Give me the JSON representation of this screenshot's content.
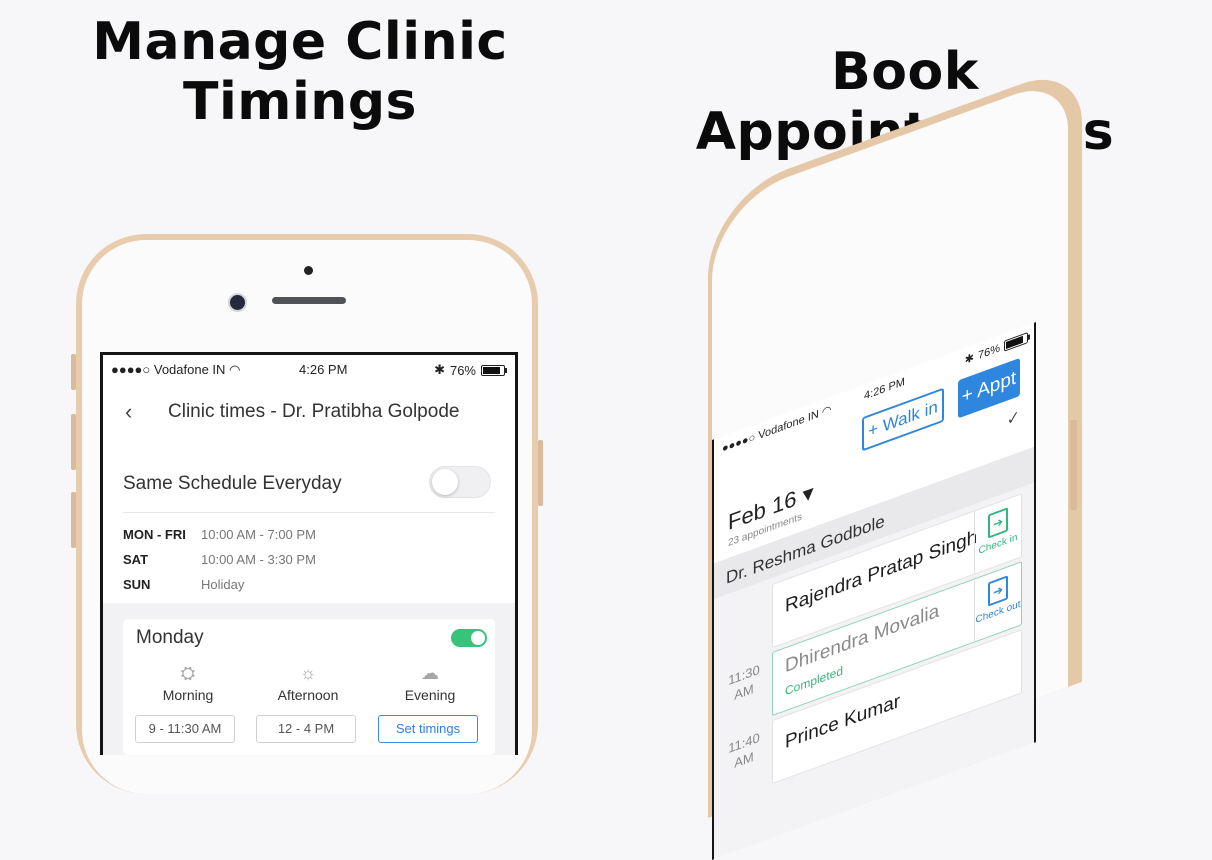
{
  "headlines": {
    "left": "Manage Clinic Timings",
    "right": "Book Appointments"
  },
  "left_phone": {
    "status": {
      "carrier": "●●●●○ Vodafone IN",
      "time": "4:26 PM",
      "battery": "76%",
      "battery_level": 0.76
    },
    "nav": {
      "back_icon": "chevron-left-icon",
      "title": "Clinic times - Dr. Pratibha Golpode"
    },
    "same_schedule": {
      "label": "Same Schedule Everyday",
      "enabled": false
    },
    "schedule": [
      {
        "days": "MON - FRI",
        "hours": "10:00 AM - 7:00 PM"
      },
      {
        "days": "SAT",
        "hours": "10:00 AM - 3:30 PM"
      },
      {
        "days": "SUN",
        "hours": "Holiday"
      }
    ],
    "day_card": {
      "day": "Monday",
      "enabled": true,
      "slots": [
        {
          "label": "Morning",
          "icon": "sunrise-icon",
          "value": "9 - 11:30 AM"
        },
        {
          "label": "Afternoon",
          "icon": "sun-icon",
          "value": "12 - 4 PM"
        },
        {
          "label": "Evening",
          "icon": "sunset-icon",
          "value": "Set timings"
        }
      ]
    },
    "accent": "#35c47a",
    "link_color": "#2f80db"
  },
  "right_phone": {
    "status": {
      "carrier": "●●●●○ Vodafone IN",
      "time": "4:26 PM",
      "battery": "76%",
      "battery_level": 0.76
    },
    "walk_in": "+ Walk in",
    "appt": "+ Appt",
    "date": "Feb 16 ▾",
    "appointment_count": "23 appointments",
    "doctor": "Dr. Reshma Godbole",
    "appointments": [
      {
        "time": "",
        "name": "Rajendra Pratap Singh",
        "status": "",
        "action": "Check in"
      },
      {
        "time": "11:30 AM",
        "name": "Dhirendra Movalia",
        "status": "Completed",
        "action": ""
      },
      {
        "time": "11:40 AM",
        "name": "Prince Kumar",
        "status": "",
        "action": "Check out"
      }
    ],
    "accent": "#2f86de",
    "completed_color": "#3ab47a"
  }
}
